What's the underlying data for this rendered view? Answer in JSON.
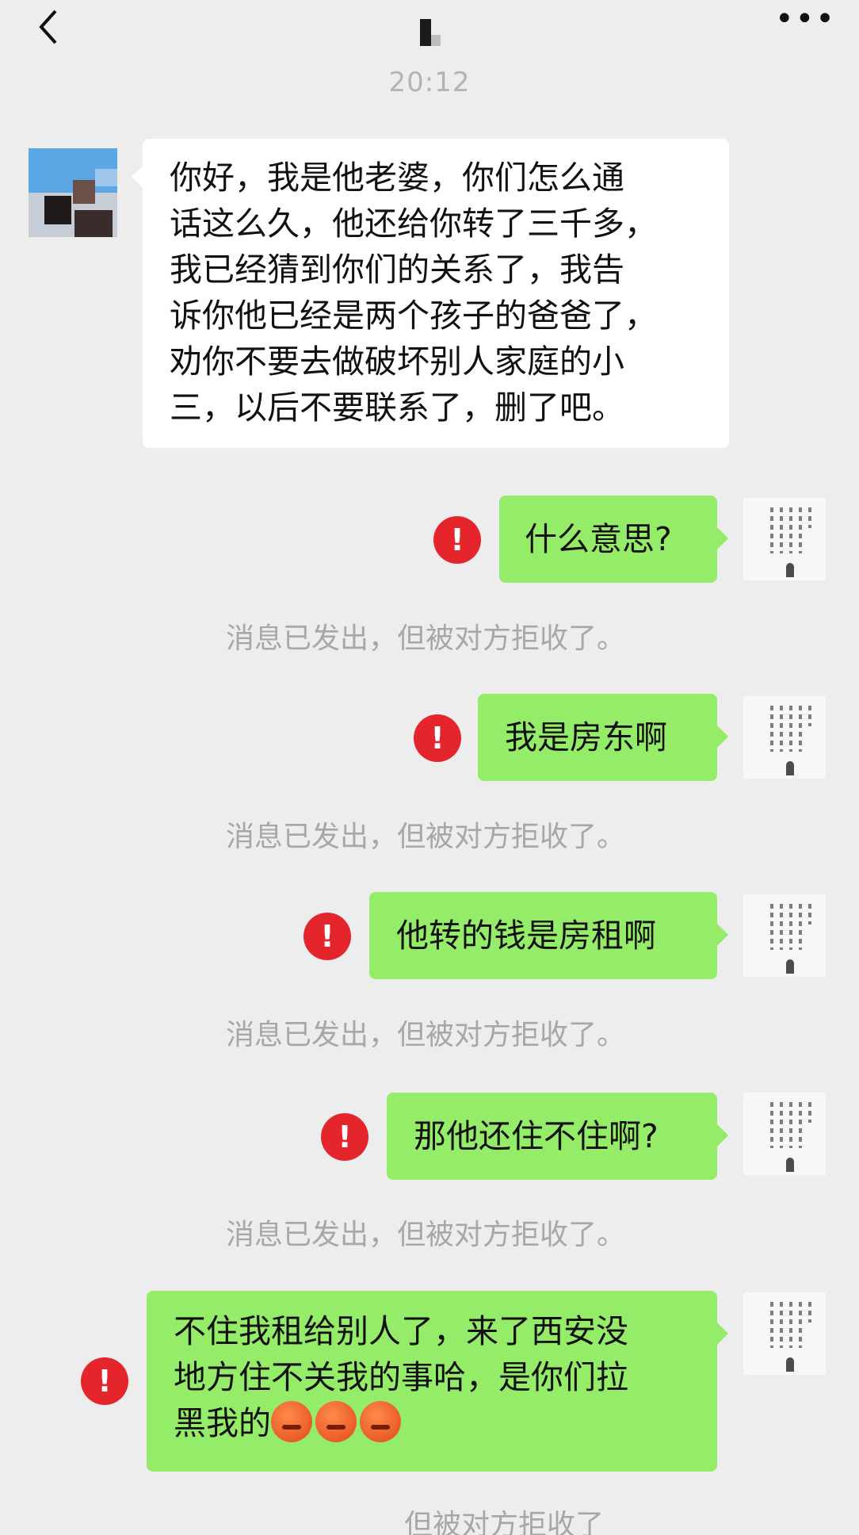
{
  "header": {
    "back_icon": "chevron-left-icon",
    "more_icon": "more-dots-icon"
  },
  "time": "20:12",
  "incoming": {
    "lines": [
      "你好，我是他老婆，你们怎么通",
      "话这么久，他还给你转了三千多，",
      "我已经猜到你们的关系了，我告",
      "诉你他已经是两个孩子的爸爸了，",
      "劝你不要去做破坏别人家庭的小",
      "三，以后不要联系了，删了吧。"
    ]
  },
  "outgoing": [
    {
      "text": "什么意思?",
      "notice": "消息已发出，但被对方拒收了。"
    },
    {
      "text": "我是房东啊",
      "notice": "消息已发出，但被对方拒收了。"
    },
    {
      "text": "他转的钱是房租啊",
      "notice": "消息已发出，但被对方拒收了。"
    },
    {
      "text": "那他还住不住啊?",
      "notice": "消息已发出，但被对方拒收了。"
    },
    {
      "lines": [
        "不住我租给别人了，来了西安没",
        "地方住不关我的事哈，是你们拉",
        "黑我的"
      ],
      "notice": "但被对方拒收了"
    }
  ],
  "error_mark": "!",
  "colors": {
    "bubble_out": "#95ec69",
    "bubble_in": "#ffffff",
    "error": "#e4262c",
    "background": "#ededed"
  }
}
